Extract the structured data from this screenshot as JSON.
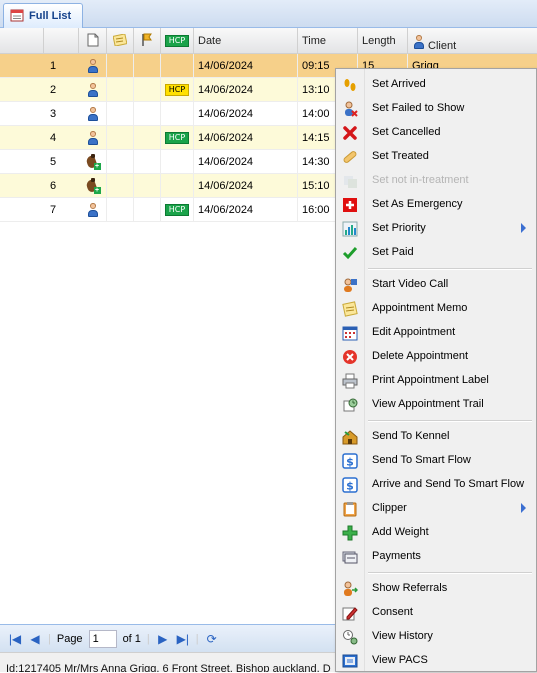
{
  "tab": {
    "label": "Full List"
  },
  "grid": {
    "headers": {
      "date": "Date",
      "time": "Time",
      "length": "Length",
      "client": "Client",
      "hcp": "HCP"
    },
    "rows": [
      {
        "num": "1",
        "icon": "person",
        "hcp": "",
        "date": "14/06/2024",
        "time": "09:15",
        "length": "15",
        "client": "Grigg",
        "style": "sel"
      },
      {
        "num": "2",
        "icon": "person",
        "hcp": "HCP",
        "hcp_color": "yellow",
        "date": "14/06/2024",
        "time": "13:10",
        "length": "",
        "client": "",
        "style": "alt"
      },
      {
        "num": "3",
        "icon": "person",
        "hcp": "",
        "date": "14/06/2024",
        "time": "14:00",
        "length": "",
        "client": "",
        "style": ""
      },
      {
        "num": "4",
        "icon": "person",
        "hcp": "HCP",
        "hcp_color": "green",
        "date": "14/06/2024",
        "time": "14:15",
        "length": "",
        "client": "",
        "style": "alt"
      },
      {
        "num": "5",
        "icon": "horse",
        "hcp": "",
        "date": "14/06/2024",
        "time": "14:30",
        "length": "",
        "client": "",
        "style": ""
      },
      {
        "num": "6",
        "icon": "horse",
        "hcp": "",
        "date": "14/06/2024",
        "time": "15:10",
        "length": "",
        "client": "",
        "style": "alt"
      },
      {
        "num": "7",
        "icon": "person",
        "hcp": "HCP",
        "hcp_color": "green",
        "date": "14/06/2024",
        "time": "16:00",
        "length": "",
        "client": "",
        "style": ""
      }
    ]
  },
  "pager": {
    "page_label": "Page",
    "page_value": "1",
    "of_label": "of 1"
  },
  "status_bar": {
    "text": "Id:1217405  Mr/Mrs Anna Grigg, 6 Front Street, Bishop auckland, D"
  },
  "context_menu": {
    "items": [
      {
        "label": "Set Arrived",
        "icon": "footprints-icon",
        "group": 1
      },
      {
        "label": "Set Failed to Show",
        "icon": "person-cross-icon",
        "group": 1
      },
      {
        "label": "Set Cancelled",
        "icon": "red-x-icon",
        "group": 1
      },
      {
        "label": "Set Treated",
        "icon": "bandage-icon",
        "group": 1
      },
      {
        "label": "Set not in-treatment",
        "icon": "not-in-treatment-icon",
        "group": 1,
        "disabled": true
      },
      {
        "label": "Set As Emergency",
        "icon": "emergency-cross-icon",
        "group": 1
      },
      {
        "label": "Set Priority",
        "icon": "priority-chart-icon",
        "group": 1,
        "submenu": true
      },
      {
        "label": "Set Paid",
        "icon": "checkmark-icon",
        "group": 1
      },
      {
        "label": "Start Video Call",
        "icon": "video-call-icon",
        "group": 2
      },
      {
        "label": "Appointment Memo",
        "icon": "memo-icon",
        "group": 2
      },
      {
        "label": "Edit Appointment",
        "icon": "calendar-edit-icon",
        "group": 2
      },
      {
        "label": "Delete Appointment",
        "icon": "delete-icon",
        "group": 2
      },
      {
        "label": "Print Appointment Label",
        "icon": "printer-icon",
        "group": 2
      },
      {
        "label": "View Appointment Trail",
        "icon": "trail-icon",
        "group": 2
      },
      {
        "label": "Send To Kennel",
        "icon": "kennel-icon",
        "group": 3
      },
      {
        "label": "Send To Smart Flow",
        "icon": "smart-flow-icon",
        "group": 3
      },
      {
        "label": "Arrive and Send To Smart Flow",
        "icon": "smart-flow-icon",
        "group": 3
      },
      {
        "label": "Clipper",
        "icon": "clipboard-icon",
        "group": 3,
        "submenu": true
      },
      {
        "label": "Add Weight",
        "icon": "green-plus-icon",
        "group": 3
      },
      {
        "label": "Payments",
        "icon": "payments-icon",
        "group": 3
      },
      {
        "label": "Show Referrals",
        "icon": "referrals-icon",
        "group": 4
      },
      {
        "label": "Consent",
        "icon": "consent-pen-icon",
        "group": 4
      },
      {
        "label": "View History",
        "icon": "history-icon",
        "group": 4
      },
      {
        "label": "View PACS",
        "icon": "pacs-icon",
        "group": 4
      }
    ]
  },
  "colors": {
    "selected_row": "#f6d08a",
    "alt_row": "#fdfad9",
    "hcp_green": "#1aa34a",
    "hcp_yellow": "#ffe000",
    "accent": "#15428b"
  }
}
